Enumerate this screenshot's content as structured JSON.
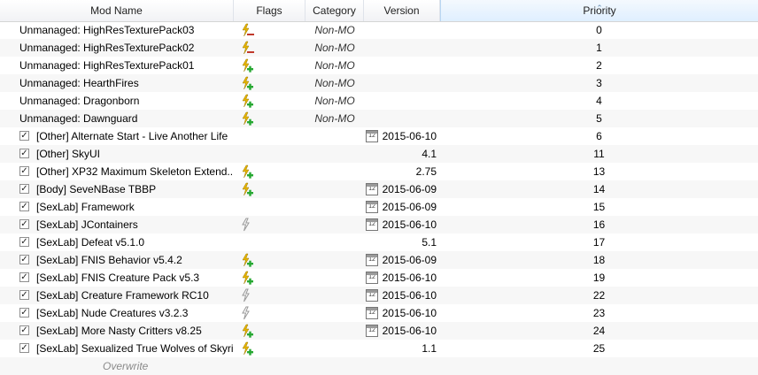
{
  "columns": {
    "name": "Mod Name",
    "flags": "Flags",
    "category": "Category",
    "version": "Version",
    "priority": "Priority"
  },
  "colors": {
    "lightning": "#e6b400",
    "plus": "#27a832",
    "minus": "#c0392b",
    "grey_bolt": "#9a9a9a"
  },
  "rows": [
    {
      "name": "Unmanaged: HighResTexturePack03",
      "checkbox": false,
      "flag": "lightning-minus-icon",
      "category": "Non-MO",
      "date": false,
      "version": "",
      "priority": "0"
    },
    {
      "name": "Unmanaged: HighResTexturePack02",
      "checkbox": false,
      "flag": "lightning-minus-icon",
      "category": "Non-MO",
      "date": false,
      "version": "",
      "priority": "1"
    },
    {
      "name": "Unmanaged: HighResTexturePack01",
      "checkbox": false,
      "flag": "lightning-plus-icon",
      "category": "Non-MO",
      "date": false,
      "version": "",
      "priority": "2"
    },
    {
      "name": "Unmanaged: HearthFires",
      "checkbox": false,
      "flag": "lightning-plus-icon",
      "category": "Non-MO",
      "date": false,
      "version": "",
      "priority": "3"
    },
    {
      "name": "Unmanaged: Dragonborn",
      "checkbox": false,
      "flag": "lightning-plus-icon",
      "category": "Non-MO",
      "date": false,
      "version": "",
      "priority": "4"
    },
    {
      "name": "Unmanaged: Dawnguard",
      "checkbox": false,
      "flag": "lightning-plus-icon",
      "category": "Non-MO",
      "date": false,
      "version": "",
      "priority": "5"
    },
    {
      "name": "[Other] Alternate Start - Live Another Life",
      "checkbox": true,
      "flag": "",
      "category": "",
      "date": true,
      "version": "2015-06-10",
      "priority": "6"
    },
    {
      "name": "[Other] SkyUI",
      "checkbox": true,
      "flag": "",
      "category": "",
      "date": false,
      "version": "4.1",
      "priority": "11"
    },
    {
      "name": "[Other] XP32 Maximum Skeleton Extend...",
      "checkbox": true,
      "flag": "lightning-plus-icon",
      "category": "",
      "date": false,
      "version": "2.75",
      "priority": "13"
    },
    {
      "name": "[Body] SeveNBase TBBP",
      "checkbox": true,
      "flag": "lightning-plus-icon",
      "category": "",
      "date": true,
      "version": "2015-06-09",
      "priority": "14"
    },
    {
      "name": "[SexLab] Framework",
      "checkbox": true,
      "flag": "",
      "category": "",
      "date": true,
      "version": "2015-06-09",
      "priority": "15"
    },
    {
      "name": "[SexLab] JContainers",
      "checkbox": true,
      "flag": "grey-lightning-icon",
      "category": "",
      "date": true,
      "version": "2015-06-10",
      "priority": "16"
    },
    {
      "name": "[SexLab] Defeat v5.1.0",
      "checkbox": true,
      "flag": "",
      "category": "",
      "date": false,
      "version": "5.1",
      "priority": "17"
    },
    {
      "name": "[SexLab] FNIS Behavior v5.4.2",
      "checkbox": true,
      "flag": "lightning-plus-icon",
      "category": "",
      "date": true,
      "version": "2015-06-09",
      "priority": "18"
    },
    {
      "name": "[SexLab] FNIS Creature Pack v5.3",
      "checkbox": true,
      "flag": "lightning-plus-icon",
      "category": "",
      "date": true,
      "version": "2015-06-10",
      "priority": "19"
    },
    {
      "name": "[SexLab] Creature Framework RC10",
      "checkbox": true,
      "flag": "grey-lightning-icon",
      "category": "",
      "date": true,
      "version": "2015-06-10",
      "priority": "22"
    },
    {
      "name": "[SexLab] Nude Creatures v3.2.3",
      "checkbox": true,
      "flag": "grey-lightning-icon",
      "category": "",
      "date": true,
      "version": "2015-06-10",
      "priority": "23"
    },
    {
      "name": "[SexLab] More Nasty Critters v8.25",
      "checkbox": true,
      "flag": "lightning-plus-icon",
      "category": "",
      "date": true,
      "version": "2015-06-10",
      "priority": "24"
    },
    {
      "name": "[SexLab] Sexualized True Wolves of Skyri...",
      "checkbox": true,
      "flag": "lightning-plus-icon",
      "category": "",
      "date": false,
      "version": "1.1",
      "priority": "25"
    }
  ],
  "overwrite": {
    "name": "Overwrite"
  },
  "calendar_glyph": "12"
}
